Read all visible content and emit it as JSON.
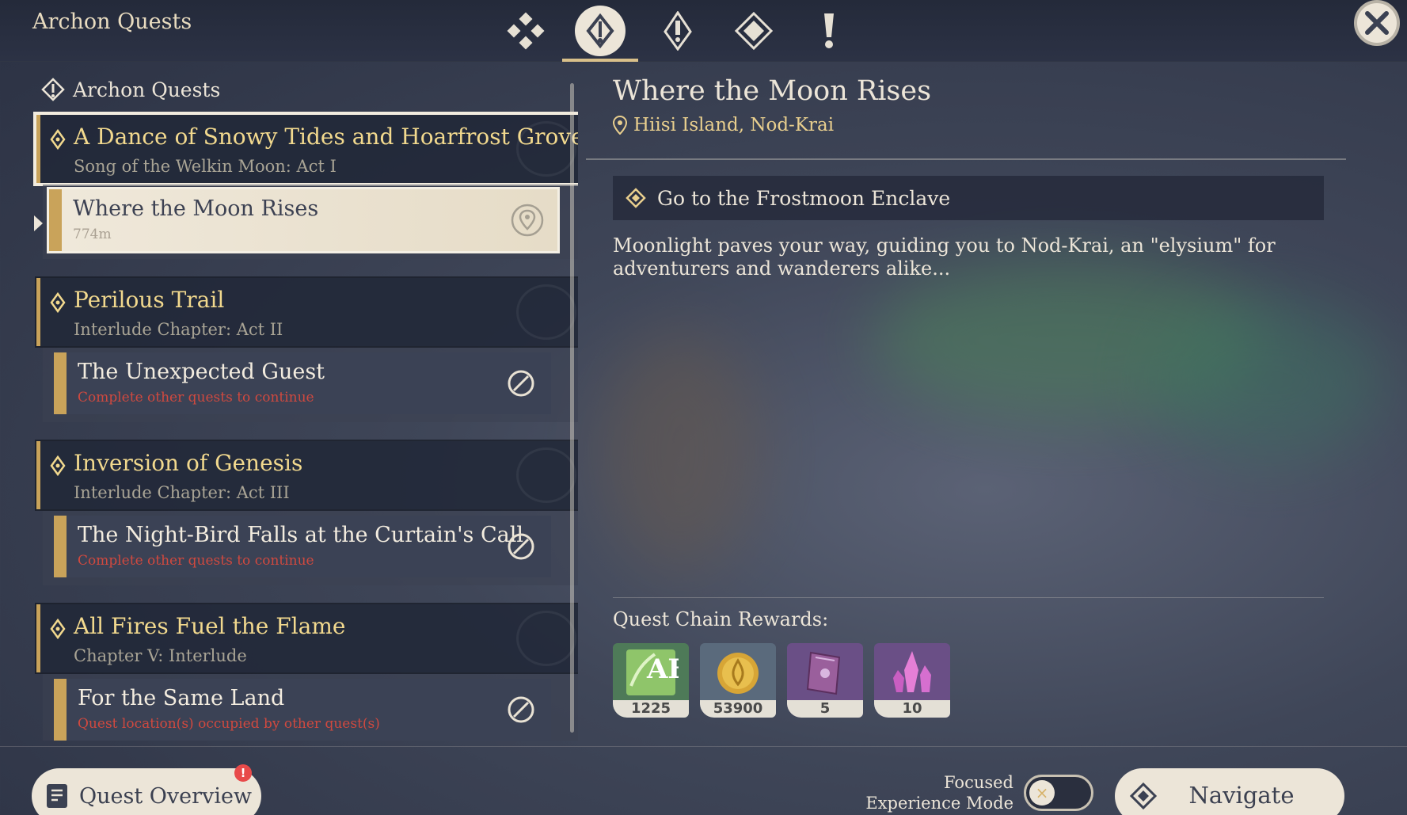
{
  "header": {
    "title": "Archon Quests",
    "tabs": [
      {
        "icon": "all-quests-icon"
      },
      {
        "icon": "archon-quest-icon",
        "active": true
      },
      {
        "icon": "story-quest-icon"
      },
      {
        "icon": "world-quest-icon"
      },
      {
        "icon": "commission-icon"
      }
    ],
    "close_icon": "close-icon"
  },
  "list": {
    "header": "Archon Quests",
    "chapters": [
      {
        "title": "A Dance of Snowy Tides and Hoarfrost Groves",
        "subtitle": "Song of the Welkin Moon: Act I",
        "selected": true,
        "quest": {
          "title": "Where the Moon Rises",
          "subtitle": "774m",
          "status_icon": "map-pin-icon",
          "active": true
        }
      },
      {
        "title": "Perilous Trail",
        "subtitle": "Interlude Chapter: Act II",
        "quest": {
          "title": "The Unexpected Guest",
          "subtitle": "Complete other quests to continue",
          "status_icon": "blocked-icon"
        }
      },
      {
        "title": "Inversion of Genesis",
        "subtitle": "Interlude Chapter: Act III",
        "quest": {
          "title": "The Night-Bird Falls at the Curtain's Call",
          "subtitle": "Complete other quests to continue",
          "status_icon": "blocked-icon"
        }
      },
      {
        "title": "All Fires Fuel the Flame",
        "subtitle": "Chapter V: Interlude",
        "quest": {
          "title": "For the Same Land",
          "subtitle": "Quest location(s) occupied by other quest(s)",
          "status_icon": "blocked-icon"
        }
      }
    ]
  },
  "detail": {
    "title": "Where the Moon Rises",
    "location": "Hiisi Island, Nod-Krai",
    "objective": "Go to the Frostmoon Enclave",
    "description": "Moonlight paves your way, guiding you to Nod-Krai, an \"elysium\" for adventurers and wanderers alike...",
    "rewards_label": "Quest Chain Rewards:",
    "rewards": [
      {
        "icon": "adventure-exp-icon",
        "count": "1225",
        "color": "#4e7a58"
      },
      {
        "icon": "mora-coin-icon",
        "count": "53900",
        "color": "#5a6a7c"
      },
      {
        "icon": "heros-wit-book-icon",
        "count": "5",
        "color": "#6a4f86"
      },
      {
        "icon": "mystic-crystal-icon",
        "count": "10",
        "color": "#6a4f86"
      }
    ]
  },
  "footer": {
    "overview_label": "Quest Overview",
    "overview_badge": "!",
    "focus_label_line1": "Focused",
    "focus_label_line2": "Experience Mode",
    "focus_enabled": false,
    "navigate_label": "Navigate"
  },
  "colors": {
    "accent_gold": "#c9a35a",
    "title_gold": "#f2d98e",
    "panel_dark": "#21283a",
    "cream": "#ece5d8",
    "blocked_red": "#d0493f"
  }
}
